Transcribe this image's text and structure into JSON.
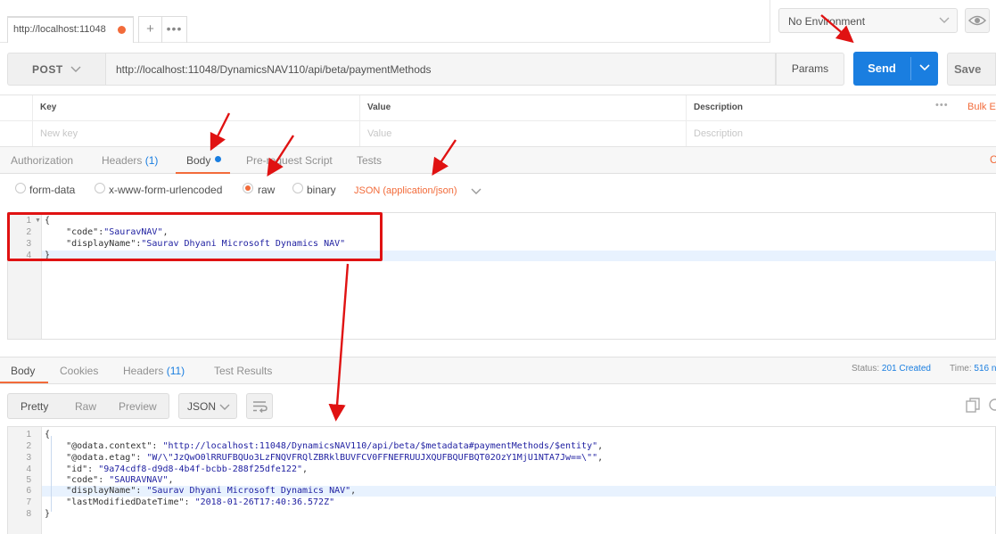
{
  "tabs": {
    "active_tab": "http://localhost:11048",
    "new_tab": "+",
    "more": "•••"
  },
  "environment": {
    "selected": "No Environment"
  },
  "request": {
    "method": "POST",
    "url": "http://localhost:11048/DynamicsNAV110/api/beta/paymentMethods",
    "params_label": "Params",
    "send_label": "Send",
    "save_label": "Save"
  },
  "params_table": {
    "headers": [
      "Key",
      "Value",
      "Description"
    ],
    "placeholders": [
      "New key",
      "Value",
      "Description"
    ],
    "more": "•••",
    "bulk_edit": "Bulk E"
  },
  "request_tabs": {
    "authorization": "Authorization",
    "headers": "Headers",
    "headers_count": "(1)",
    "body": "Body",
    "prerequest": "Pre-request Script",
    "tests": "Tests",
    "edge": "C"
  },
  "body_types": {
    "form_data": "form-data",
    "urlencoded": "x-www-form-urlencoded",
    "raw": "raw",
    "binary": "binary",
    "selected": "raw",
    "content_type": "JSON (application/json)"
  },
  "request_body": {
    "lines": [
      {
        "n": "1",
        "text": "{"
      },
      {
        "n": "2",
        "key": "    \"code\":",
        "value": "\"SauravNAV\"",
        "tail": ","
      },
      {
        "n": "3",
        "key": "    \"displayName\":",
        "value": "\"Saurav Dhyani Microsoft Dynamics NAV\"",
        "tail": ""
      },
      {
        "n": "4",
        "text": "}"
      }
    ]
  },
  "response_tabs": {
    "body": "Body",
    "cookies": "Cookies",
    "headers": "Headers",
    "headers_count": "(11)",
    "test_results": "Test Results"
  },
  "response_status": {
    "status_label": "Status:",
    "status_value": "201 Created",
    "time_label": "Time:",
    "time_value": "516 n"
  },
  "response_view": {
    "pretty": "Pretty",
    "raw": "Raw",
    "preview": "Preview",
    "format": "JSON"
  },
  "response_body": {
    "lines": [
      {
        "n": "1",
        "text": "{"
      },
      {
        "n": "2",
        "key": "    \"@odata.context\": ",
        "value": "\"http://localhost:11048/DynamicsNAV110/api/beta/$metadata#paymentMethods/$entity\"",
        "tail": ","
      },
      {
        "n": "3",
        "key": "    \"@odata.etag\": ",
        "value": "\"W/\\\"JzQwO0lRRUFBQUo3LzFNQVFRQlZBRklBUVFCV0FFNEFRUUJXQUFBQUFBQT02OzY1MjU1NTA7Jw==\\\"\"",
        "tail": ","
      },
      {
        "n": "4",
        "key": "    \"id\": ",
        "value": "\"9a74cdf8-d9d8-4b4f-bcbb-288f25dfe122\"",
        "tail": ","
      },
      {
        "n": "5",
        "key": "    \"code\": ",
        "value": "\"SAURAVNAV\"",
        "tail": ","
      },
      {
        "n": "6",
        "key": "    \"displayName\": ",
        "value": "\"Saurav Dhyani Microsoft Dynamics NAV\"",
        "tail": ","
      },
      {
        "n": "7",
        "key": "    \"lastModifiedDateTime\": ",
        "value": "\"2018-01-26T17:40:36.572Z\"",
        "tail": ""
      },
      {
        "n": "8",
        "text": "}"
      }
    ]
  },
  "colors": {
    "accent_orange": "#f26b3a",
    "send_blue": "#1a7ee0",
    "annotation_red": "#e01212"
  }
}
